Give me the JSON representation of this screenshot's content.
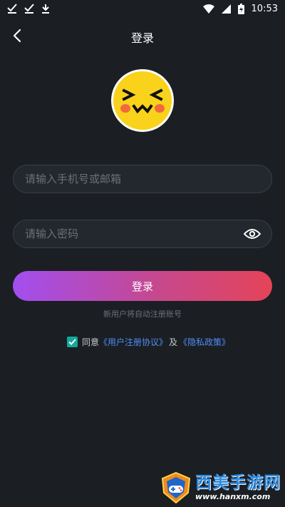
{
  "status_bar": {
    "time": "10:53",
    "left_icons": [
      "check-download-icon",
      "check-download-icon",
      "download-icon"
    ],
    "right_icons": [
      "wifi-icon",
      "signal-icon",
      "battery-icon"
    ]
  },
  "header": {
    "title": "登录",
    "back_icon": "chevron-left-icon"
  },
  "logo": {
    "icon": "smiley-face-logo"
  },
  "form": {
    "phone_placeholder": "请输入手机号或邮箱",
    "password_placeholder": "请输入密码",
    "password_toggle_icon": "eye-icon"
  },
  "login_button_label": "登录",
  "hint": "新用户将自动注册账号",
  "agreement": {
    "checked": true,
    "agree_text": "同意",
    "user_agreement_link": "《用户注册协议》",
    "and_text": "及",
    "privacy_link": "《隐私政策》"
  },
  "watermark": {
    "title": "西美手游网",
    "url": "www.hanxm.com"
  },
  "colors": {
    "background": "#1b1e23",
    "gradient_start": "#a24ef0",
    "gradient_end": "#e44458",
    "checkbox": "#13a89a",
    "link": "#4f8ff7"
  }
}
